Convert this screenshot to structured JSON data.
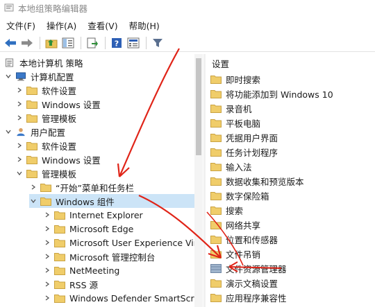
{
  "window": {
    "title": "本地组策略编辑器"
  },
  "menubar": {
    "items": [
      "文件(F)",
      "操作(A)",
      "查看(V)",
      "帮助(H)"
    ]
  },
  "toolbar": {
    "icons": [
      "back-arrow-icon",
      "forward-arrow-icon",
      "up-folder-icon",
      "show-hide-tree-icon",
      "export-list-icon",
      "help-icon",
      "properties-icon",
      "filter-icon"
    ]
  },
  "tree": {
    "root": "本地计算机 策略",
    "computer_config": "计算机配置",
    "computer_children": [
      "软件设置",
      "Windows 设置",
      "管理模板"
    ],
    "user_config": "用户配置",
    "user_children": [
      "软件设置",
      "Windows 设置",
      "管理模板"
    ],
    "admin_templates_children": [
      "“开始”菜单和任务栏",
      "Windows 组件"
    ],
    "windows_components_children": [
      "Internet Explorer",
      "Microsoft Edge",
      "Microsoft User Experience Vir",
      "Microsoft 管理控制台",
      "NetMeeting",
      "RSS 源",
      "Windows Defender SmartScre"
    ]
  },
  "list": {
    "header": "设置",
    "items": [
      "即时搜索",
      "将功能添加到 Windows 10",
      "录音机",
      "平板电脑",
      "凭据用户界面",
      "任务计划程序",
      "输入法",
      "数据收集和预览版本",
      "数字保险箱",
      "搜索",
      "网络共享",
      "位置和传感器",
      "文件吊销",
      "文件资源管理器",
      "演示文稿设置",
      "应用程序兼容性"
    ]
  },
  "colors": {
    "selection": "#cce4f7",
    "folder": "#e8c35a",
    "arrow": "#e02418"
  }
}
